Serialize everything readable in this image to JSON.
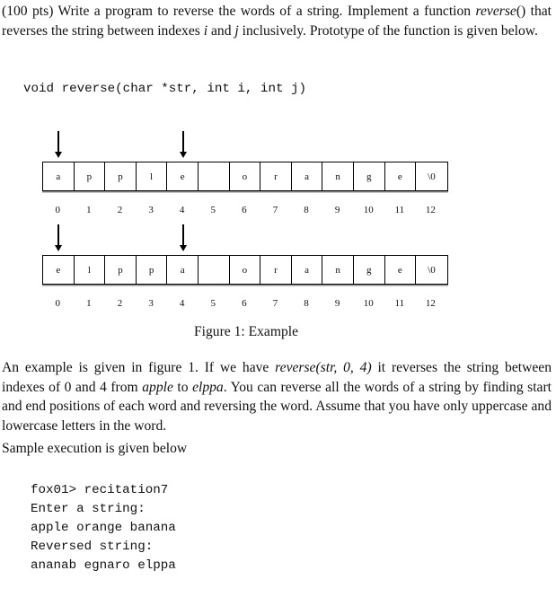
{
  "intro": {
    "points": "(100 pts)",
    "text1": " Write a program to reverse the words of a string. Implement a function ",
    "func_name": "reverse",
    "text2": "() that reverses the string between indexes ",
    "var_i": "i",
    "text3": " and ",
    "var_j": "j",
    "text4": " inclusively. Prototype of the function is given below."
  },
  "prototype": "void reverse(char *str, int i, int j)",
  "figure": {
    "caption": "Figure 1: Example",
    "before": {
      "cells": [
        "a",
        "p",
        "p",
        "l",
        "e",
        "",
        "o",
        "r",
        "a",
        "n",
        "g",
        "e",
        "\\0"
      ],
      "indexes": [
        "0",
        "1",
        "2",
        "3",
        "4",
        "5",
        "6",
        "7",
        "8",
        "9",
        "10",
        "11",
        "12"
      ],
      "arrow_indexes": [
        0,
        4
      ]
    },
    "after": {
      "cells": [
        "e",
        "l",
        "p",
        "p",
        "a",
        "",
        "o",
        "r",
        "a",
        "n",
        "g",
        "e",
        "\\0"
      ],
      "indexes": [
        "0",
        "1",
        "2",
        "3",
        "4",
        "5",
        "6",
        "7",
        "8",
        "9",
        "10",
        "11",
        "12"
      ],
      "arrow_indexes": [
        0,
        4
      ]
    }
  },
  "explanation": {
    "text1": "An example is given in figure 1. If we have ",
    "call": "reverse(str, 0, 4)",
    "text2": " it reverses the string between indexes of 0 and 4 from ",
    "word_before": "apple",
    "text3": " to ",
    "word_after": "elppa",
    "text4": ". You can reverse all the words of a string by finding start and end positions of each word and reversing the word. Assume that you have only uppercase and lowercase letters in the word."
  },
  "sample_label": "Sample execution is given below",
  "terminal": {
    "lines": [
      "fox01> recitation7",
      "Enter a string:",
      "apple orange banana",
      "Reversed string:",
      "ananab egnaro elppa"
    ]
  }
}
